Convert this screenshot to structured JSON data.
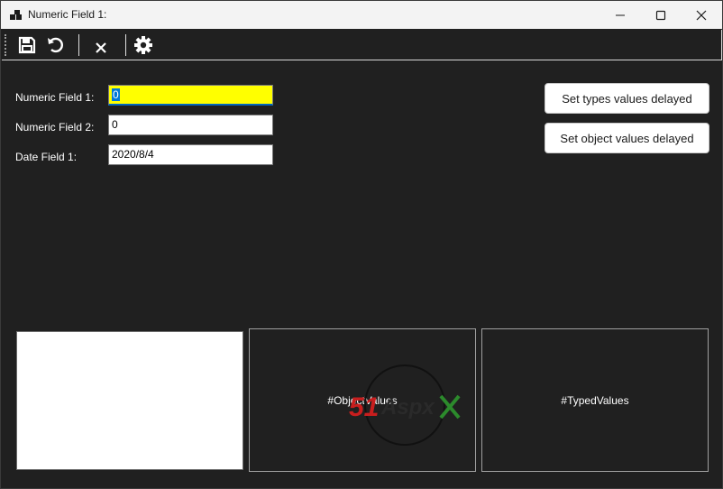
{
  "window": {
    "title": "Numeric Field 1:"
  },
  "toolbar": {
    "items": [
      "save-icon",
      "undo-icon",
      "delete-icon",
      "settings-icon"
    ]
  },
  "form": {
    "fields": [
      {
        "label": "Numeric Field 1:",
        "value": "0"
      },
      {
        "label": "Numeric Field 2:",
        "value": "0"
      },
      {
        "label": "Date Field 1:",
        "value": "2020/8/4"
      }
    ]
  },
  "buttons": {
    "set_types": "Set types values delayed",
    "set_object": "Set object values delayed"
  },
  "panels": {
    "object_values": "#ObjectValues",
    "typed_values": "#TypedValues"
  },
  "watermark": {
    "brand_a": "51",
    "brand_b": "Aspx"
  },
  "colors": {
    "focused_bg": "#ffff00",
    "selection": "#0078d7",
    "window_bg": "#202020"
  }
}
